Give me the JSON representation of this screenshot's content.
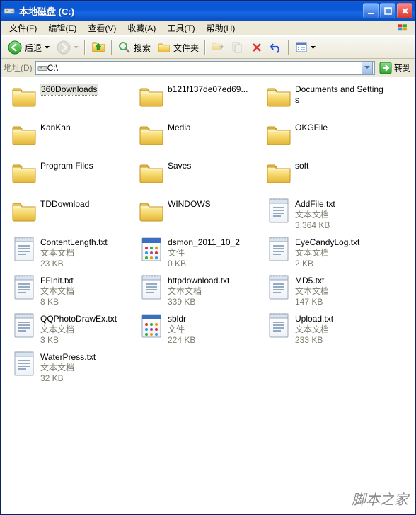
{
  "window": {
    "title": "本地磁盘 (C:)"
  },
  "menu": {
    "file": "文件(F)",
    "edit": "编辑(E)",
    "view": "查看(V)",
    "favorites": "收藏(A)",
    "tools": "工具(T)",
    "help": "帮助(H)"
  },
  "toolbar": {
    "back": "后退",
    "search": "搜索",
    "folders": "文件夹"
  },
  "address": {
    "label": "地址(D)",
    "path": "C:\\",
    "go": "转到"
  },
  "type_labels": {
    "text_doc": "文本文档",
    "file": "文件"
  },
  "items": [
    {
      "name": "360Downloads",
      "kind": "folder",
      "selected": true
    },
    {
      "name": "b121f137de07ed69...",
      "kind": "folder"
    },
    {
      "name": "Documents and Settings",
      "kind": "folder"
    },
    {
      "name": "KanKan",
      "kind": "folder"
    },
    {
      "name": "Media",
      "kind": "folder"
    },
    {
      "name": "OKGFile",
      "kind": "folder"
    },
    {
      "name": "Program Files",
      "kind": "folder"
    },
    {
      "name": "Saves",
      "kind": "folder"
    },
    {
      "name": "soft",
      "kind": "folder"
    },
    {
      "name": "TDDownload",
      "kind": "folder"
    },
    {
      "name": "WINDOWS",
      "kind": "folder"
    },
    {
      "name": "AddFile.txt",
      "kind": "txt",
      "type": "文本文档",
      "size": "3,364 KB"
    },
    {
      "name": "ContentLength.txt",
      "kind": "txt",
      "type": "文本文档",
      "size": "23 KB"
    },
    {
      "name": "dsmon_2011_10_2",
      "kind": "file",
      "type": "文件",
      "size": "0 KB"
    },
    {
      "name": "EyeCandyLog.txt",
      "kind": "txt",
      "type": "文本文档",
      "size": "2 KB"
    },
    {
      "name": "FFInit.txt",
      "kind": "txt",
      "type": "文本文档",
      "size": "8 KB"
    },
    {
      "name": "httpdownload.txt",
      "kind": "txt",
      "type": "文本文档",
      "size": "339 KB"
    },
    {
      "name": "MD5.txt",
      "kind": "txt",
      "type": "文本文档",
      "size": "147 KB"
    },
    {
      "name": "QQPhotoDrawEx.txt",
      "kind": "txt",
      "type": "文本文档",
      "size": "3 KB"
    },
    {
      "name": "sbldr",
      "kind": "file",
      "type": "文件",
      "size": "224 KB"
    },
    {
      "name": "Upload.txt",
      "kind": "txt",
      "type": "文本文档",
      "size": "233 KB"
    },
    {
      "name": "WaterPress.txt",
      "kind": "txt",
      "type": "文本文档",
      "size": "32 KB"
    }
  ],
  "watermark": "脚本之家"
}
